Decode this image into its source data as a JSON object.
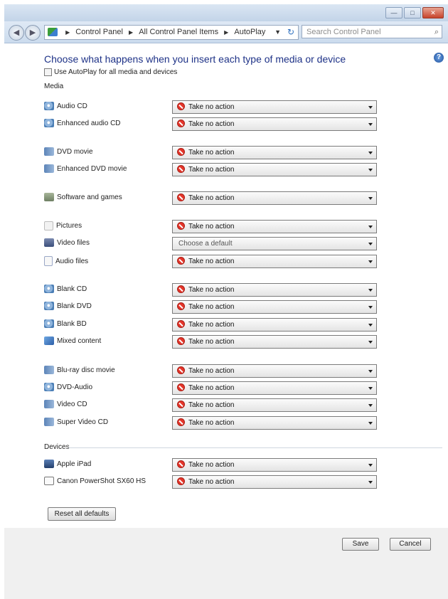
{
  "titlebar": {
    "minimize": "—",
    "maximize": "□",
    "close": "✕"
  },
  "nav": {
    "back": "◀",
    "forward": "▶"
  },
  "address": {
    "crumbs": [
      "Control Panel",
      "All Control Panel Items",
      "AutoPlay"
    ],
    "separator": "▶",
    "dropdown": "▼",
    "refresh": "↻"
  },
  "search": {
    "placeholder": "Search Control Panel",
    "icon": "⌕"
  },
  "help": "?",
  "heading": "Choose what happens when you insert each type of media or device",
  "use_autoplay": "Use AutoPlay for all media and devices",
  "sections": {
    "media": "Media",
    "devices": "Devices"
  },
  "rows": [
    {
      "label": "Audio CD",
      "icon": "disc",
      "value": "Take no action"
    },
    {
      "label": "Enhanced audio CD",
      "icon": "disc",
      "value": "Take no action"
    },
    {
      "label": "DVD movie",
      "icon": "film",
      "value": "Take no action"
    },
    {
      "label": "Enhanced DVD movie",
      "icon": "film",
      "value": "Take no action"
    },
    {
      "label": "Software and games",
      "icon": "game",
      "value": "Take no action"
    },
    {
      "label": "Pictures",
      "icon": "pic",
      "value": "Take no action"
    },
    {
      "label": "Video files",
      "icon": "video",
      "value": "Choose a default"
    },
    {
      "label": "Audio files",
      "icon": "note",
      "value": "Take no action"
    },
    {
      "label": "Blank CD",
      "icon": "disc",
      "value": "Take no action"
    },
    {
      "label": "Blank DVD",
      "icon": "disc",
      "value": "Take no action"
    },
    {
      "label": "Blank BD",
      "icon": "disc",
      "value": "Take no action"
    },
    {
      "label": "Mixed content",
      "icon": "mixed",
      "value": "Take no action"
    },
    {
      "label": "Blu-ray disc movie",
      "icon": "film",
      "value": "Take no action"
    },
    {
      "label": "DVD-Audio",
      "icon": "disc",
      "value": "Take no action"
    },
    {
      "label": "Video CD",
      "icon": "film",
      "value": "Take no action"
    },
    {
      "label": "Super Video CD",
      "icon": "film",
      "value": "Take no action"
    },
    {
      "label": "Apple iPad",
      "icon": "device",
      "value": "Take no action"
    },
    {
      "label": "Canon PowerShot SX60 HS",
      "icon": "camera",
      "value": "Take no action"
    }
  ],
  "buttons": {
    "reset": "Reset all defaults",
    "save": "Save",
    "cancel": "Cancel"
  }
}
